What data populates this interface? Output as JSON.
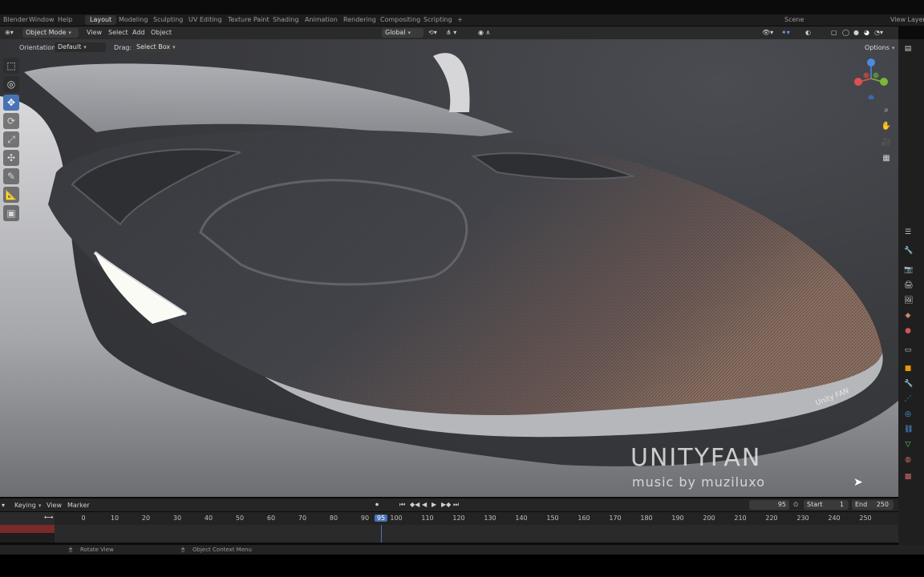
{
  "workspace_tabs": [
    "Layout",
    "Modeling",
    "Sculpting",
    "UV Editing",
    "Texture Paint",
    "Shading",
    "Animation",
    "Rendering",
    "Compositing",
    "Scripting"
  ],
  "active_workspace": "Layout",
  "top_left_menu": [
    "Blender",
    "Window",
    "Help"
  ],
  "scene_label": "Scene",
  "view_layer_label": "View Layer",
  "header": {
    "mode": "Object Mode",
    "menus": [
      "View",
      "Select",
      "Add",
      "Object"
    ],
    "transform": "Global"
  },
  "tool_settings": {
    "orientation_label": "Orientation:",
    "orientation_value": "Default",
    "drag_label": "Drag:",
    "drag_value": "Select Box",
    "options": "Options"
  },
  "toolbar_icons": [
    "select-box-icon",
    "cursor-icon",
    "move-icon",
    "rotate-icon",
    "scale-icon",
    "transform-icon",
    "annotate-icon",
    "measure-icon",
    "add-cube-icon"
  ],
  "hood_badge": "Unity FAN",
  "overlay": {
    "title": "UNITYFAN",
    "subtitle": "music by muziluxo"
  },
  "timeline": {
    "menus": [
      "Keying",
      "View",
      "Marker"
    ],
    "current_frame": "95",
    "start_label": "Start",
    "start_value": "1",
    "end_label": "End",
    "end_value": "250",
    "ticks": [
      "0",
      "10",
      "20",
      "30",
      "40",
      "50",
      "60",
      "70",
      "80",
      "90",
      "95",
      "100",
      "110",
      "120",
      "130",
      "140",
      "150",
      "160",
      "170",
      "180",
      "190",
      "200",
      "210",
      "220",
      "230",
      "240",
      "250"
    ]
  },
  "status": {
    "left": "Rotate View",
    "right": "Object Context Menu"
  },
  "colors": {
    "accent": "#4772b3",
    "axis_x": "#e05050",
    "axis_y": "#7ab83a",
    "axis_z": "#4a8be0"
  }
}
